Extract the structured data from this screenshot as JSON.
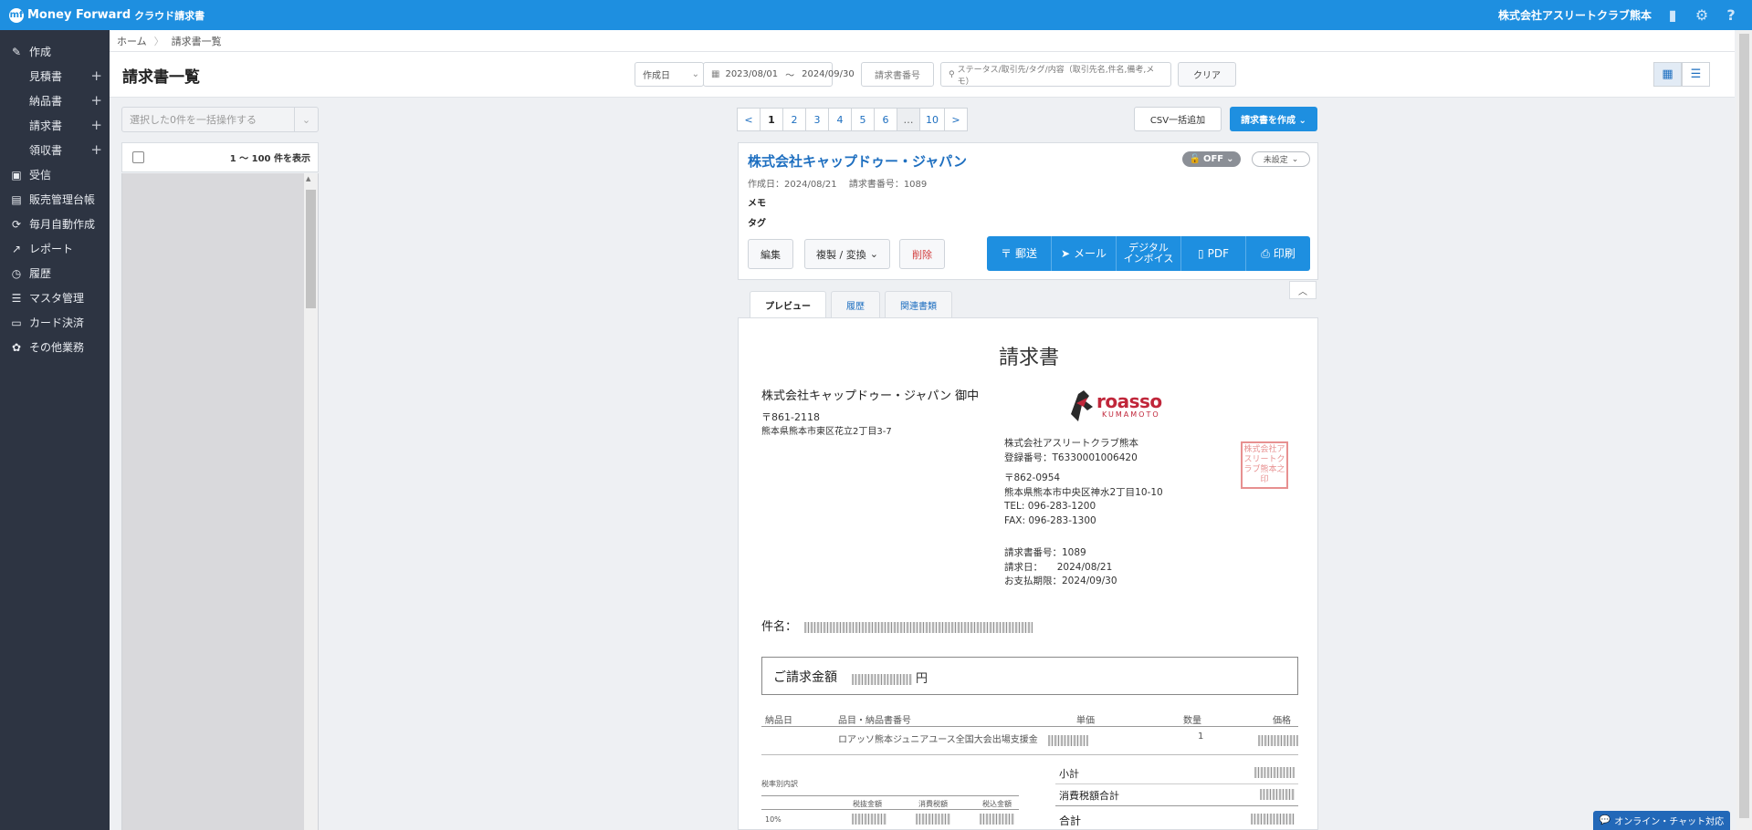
{
  "app": {
    "brand": "Money Forward",
    "product": "クラウド請求書",
    "company": "株式会社アスリートクラブ熊本"
  },
  "sidebar": {
    "create": "作成",
    "create_items": [
      {
        "label": "見積書"
      },
      {
        "label": "納品書"
      },
      {
        "label": "請求書"
      },
      {
        "label": "領収書"
      }
    ],
    "items": [
      {
        "label": "受信",
        "icon": "inbox-icon"
      },
      {
        "label": "販売管理台帳",
        "icon": "ledger-icon"
      },
      {
        "label": "毎月自動作成",
        "icon": "repeat-icon"
      },
      {
        "label": "レポート",
        "icon": "chart-icon"
      },
      {
        "label": "履歴",
        "icon": "history-icon"
      },
      {
        "label": "マスタ管理",
        "icon": "list-icon"
      },
      {
        "label": "カード決済",
        "icon": "card-icon"
      },
      {
        "label": "その他業務",
        "icon": "apps-icon"
      }
    ]
  },
  "breadcrumb": {
    "home": "ホーム",
    "current": "請求書一覧"
  },
  "header": {
    "title": "請求書一覧",
    "date_type": "作成日",
    "date_from": "2023/08/01",
    "date_sep": "～",
    "date_to": "2024/09/30",
    "invoice_no_placeholder": "請求書番号",
    "search_placeholder": "ステータス/取引先/タグ/内容（取引先名,件名,備考,メモ）",
    "clear": "クリア"
  },
  "list": {
    "bulk_placeholder": "選択した0件を一括操作する",
    "count": "1 ～ 100 件を表示"
  },
  "pager": {
    "prev": "<",
    "pages": [
      "1",
      "2",
      "3",
      "4",
      "5",
      "6"
    ],
    "dots": "…",
    "last": "10",
    "next": ">"
  },
  "actions": {
    "csv": "CSV一括追加",
    "create": "請求書を作成 ⌄"
  },
  "detail": {
    "client": "株式会社キャップドゥー・ジャパン",
    "lock": "OFF",
    "status": "未設定",
    "meta": "作成日：2024/08/21　 請求書番号：1089",
    "memo": "メモ",
    "tag": "タグ",
    "edit": "編集",
    "copy": "複製 / 変換",
    "delete": "削除",
    "mail_post": "郵送",
    "mail": "メール",
    "digital_1": "デジタル",
    "digital_2": "インボイス",
    "pdf": "PDF",
    "print": "印刷"
  },
  "tabs": [
    "プレビュー",
    "履歴",
    "関連書類"
  ],
  "document": {
    "title": "請求書",
    "client": "株式会社キャップドゥー・ジャパン 御中",
    "client_zip": "〒861-2118",
    "client_addr": "熊本県熊本市東区花立2丁目3-7",
    "logo_word": "roasso",
    "logo_sub": "KUMAMOTO",
    "issuer_name": "株式会社アスリートクラブ熊本",
    "issuer_reg": "登録番号：T6330001006420",
    "issuer_zip": "〒862-0954",
    "issuer_addr": "熊本県熊本市中央区神水2丁目10-10",
    "issuer_tel": "TEL: 096-283-1200",
    "issuer_fax": "FAX: 096-283-1300",
    "inv_no": "請求書番号：1089",
    "inv_date": "請求日：　　2024/08/21",
    "due": "お支払期限：2024/09/30",
    "seal": "株式会社アスリートクラブ熊本之印",
    "subject_label": "件名：",
    "amount_label": "ご請求金額",
    "amount_unit": "円",
    "col_date": "納品日",
    "col_item": "品目・納品書番号",
    "col_price": "単価",
    "col_qty": "数量",
    "col_total": "価格",
    "item_name": "ロアッソ熊本ジュニアユース全国大会出場支援金",
    "item_qty": "1",
    "subtotal": "小計",
    "tax_total": "消費税額合計",
    "total": "合計",
    "tax_breakdown": "税率別内訳",
    "tax_col1": "税抜金額",
    "tax_col2": "消費税額",
    "tax_col3": "税込金額",
    "tax_rate": "10%"
  },
  "chat": "オンライン・チャット対応"
}
